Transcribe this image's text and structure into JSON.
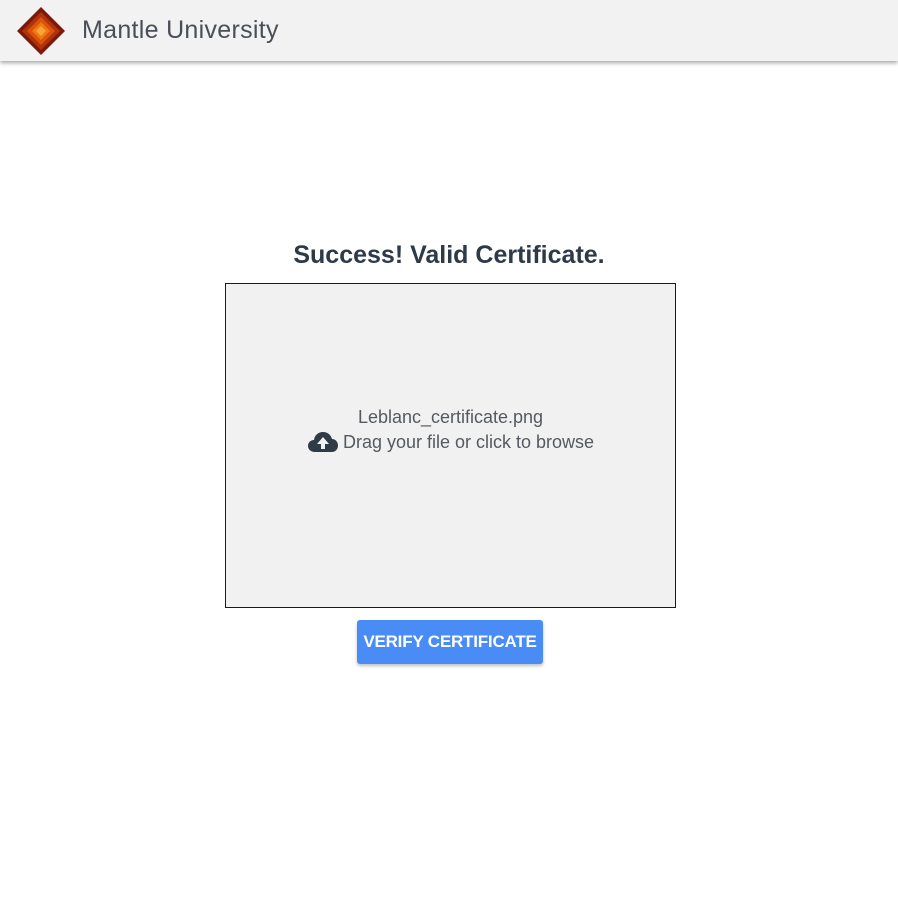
{
  "header": {
    "brand": "Mantle University",
    "logo_icon": "mantle-diamond-logo",
    "background": "#f2f2f2"
  },
  "main": {
    "status_title": "Success! Valid Certificate.",
    "dropzone": {
      "filename": "Leblanc_certificate.png",
      "hint": "Drag your file or click to browse",
      "icon": "cloud-upload-icon"
    },
    "verify_button": "VERIFY CERTIFICATE"
  },
  "colors": {
    "accent": "#4a8cf5",
    "title": "#2e3a48",
    "logo_dark": "#7a1a08",
    "logo_mid": "#c23a0c",
    "logo_light": "#f07a10"
  }
}
